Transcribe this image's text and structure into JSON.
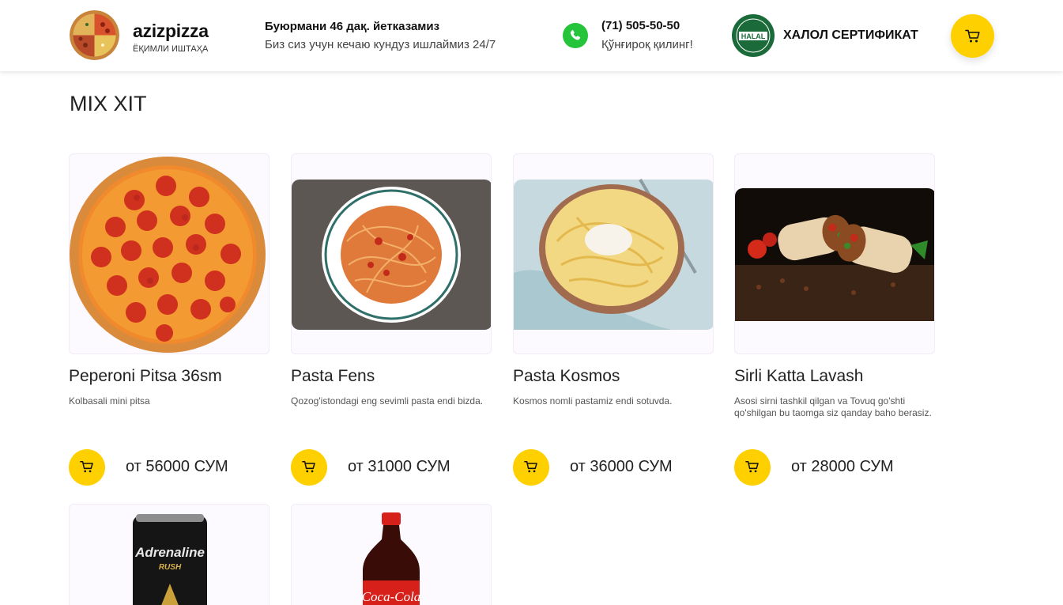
{
  "header": {
    "brand_name": "azizpizza",
    "brand_sub": "ЁҚИМЛИ ИШТАҲА",
    "delivery_title": "Буюрмани 46 дақ. йетказамиз",
    "delivery_sub": "Биз сиз учун кечаю кундуз ишлаймиз 24/7",
    "phone_number": "(71) 505-50-50",
    "phone_sub": "Қўнғироқ қилинг!",
    "halal_badge_text": "HALAL",
    "halal_label": "ХАЛОЛ СЕРТИФИКАТ"
  },
  "section_title": "MIX XIT",
  "products": [
    {
      "name": "Peperoni Pitsa 36sm",
      "description": "Kolbasali mini pitsa",
      "price": "от 56000 СУМ"
    },
    {
      "name": "Pasta Fens",
      "description": "Qozog'istondagi eng sevimli pasta endi bizda.",
      "price": "от 31000 СУМ"
    },
    {
      "name": "Pasta Kosmos",
      "description": "Kosmos nomli pastamiz endi sotuvda.",
      "price": "от 36000 СУМ"
    },
    {
      "name": "Sirli Katta Lavash",
      "description": "Asosi sirni tashkil qilgan va Tovuq go'shti qo'shilgan bu taomga siz qanday baho berasiz.",
      "price": "от 28000 СУМ"
    }
  ],
  "drinks": [
    {
      "brand": "Adrenaline",
      "sub": "RUSH"
    },
    {
      "brand": "Coca-Cola"
    }
  ],
  "colors": {
    "accent": "#ffd000",
    "whatsapp": "#25c43b",
    "halal": "#1b6b3a"
  }
}
